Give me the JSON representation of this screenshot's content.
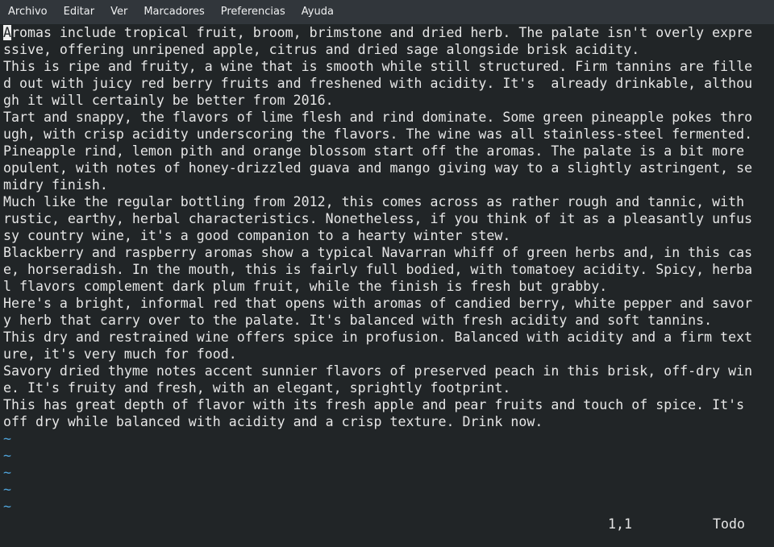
{
  "menu": {
    "items": [
      "Archivo",
      "Editar",
      "Ver",
      "Marcadores",
      "Preferencias",
      "Ayuda"
    ]
  },
  "editor": {
    "cursor_char": "A",
    "first_line_rest": "romas include tropical fruit, broom, brimstone and dried herb. The palate isn't overly expre",
    "lines": [
      "ssive, offering unripened apple, citrus and dried sage alongside brisk acidity.",
      "This is ripe and fruity, a wine that is smooth while still structured. Firm tannins are fille",
      "d out with juicy red berry fruits and freshened with acidity. It's  already drinkable, althou",
      "gh it will certainly be better from 2016.",
      "Tart and snappy, the flavors of lime flesh and rind dominate. Some green pineapple pokes thro",
      "ugh, with crisp acidity underscoring the flavors. The wine was all stainless-steel fermented.",
      "Pineapple rind, lemon pith and orange blossom start off the aromas. The palate is a bit more ",
      "opulent, with notes of honey-drizzled guava and mango giving way to a slightly astringent, se",
      "midry finish.",
      "Much like the regular bottling from 2012, this comes across as rather rough and tannic, with ",
      "rustic, earthy, herbal characteristics. Nonetheless, if you think of it as a pleasantly unfus",
      "sy country wine, it's a good companion to a hearty winter stew.",
      "Blackberry and raspberry aromas show a typical Navarran whiff of green herbs and, in this cas",
      "e, horseradish. In the mouth, this is fairly full bodied, with tomatoey acidity. Spicy, herba",
      "l flavors complement dark plum fruit, while the finish is fresh but grabby.",
      "Here's a bright, informal red that opens with aromas of candied berry, white pepper and savor",
      "y herb that carry over to the palate. It's balanced with fresh acidity and soft tannins.",
      "This dry and restrained wine offers spice in profusion. Balanced with acidity and a firm text",
      "ure, it's very much for food.",
      "Savory dried thyme notes accent sunnier flavors of preserved peach in this brisk, off-dry win",
      "e. It's fruity and fresh, with an elegant, sprightly footprint.",
      "This has great depth of flavor with its fresh apple and pear fruits and touch of spice. It's ",
      "off dry while balanced with acidity and a crisp texture. Drink now."
    ],
    "empty_markers": [
      "~",
      "~",
      "~",
      "~",
      "~"
    ]
  },
  "status": {
    "position": "1,1",
    "scroll": "Todo"
  },
  "colors": {
    "background": "#212527",
    "menubar": "#31363b",
    "text": "#e6e6e6",
    "tilde": "#4fa3d9"
  }
}
